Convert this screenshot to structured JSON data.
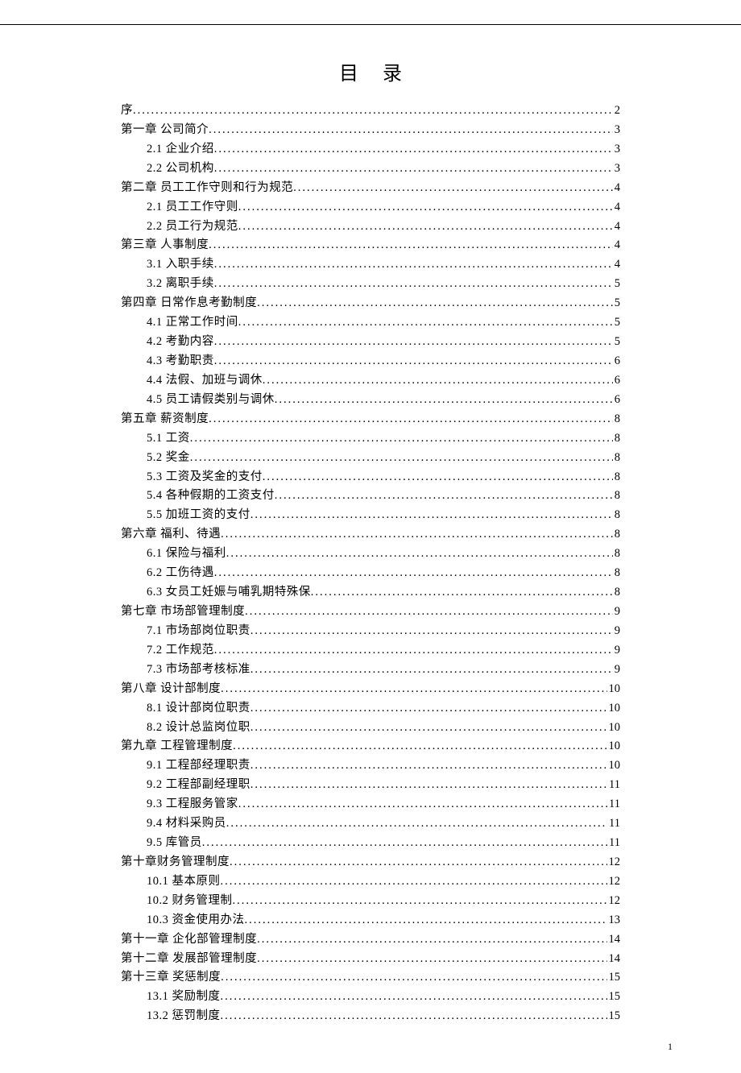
{
  "title": "目录",
  "page_number": "1",
  "toc": [
    {
      "level": 1,
      "label": "序",
      "page": "2"
    },
    {
      "level": 1,
      "label": "第一章  公司简介",
      "page": "3"
    },
    {
      "level": 2,
      "label": "2.1 企业介绍",
      "page": "3"
    },
    {
      "level": 2,
      "label": "2.2 公司机构",
      "page": "3"
    },
    {
      "level": 1,
      "label": "第二章 员工工作守则和行为规范",
      "page": "4"
    },
    {
      "level": 2,
      "label": "2.1 员工工作守则",
      "page": "4"
    },
    {
      "level": 2,
      "label": "2.2 员工行为规范",
      "page": "4"
    },
    {
      "level": 1,
      "label": "第三章 人事制度",
      "page": "4"
    },
    {
      "level": 2,
      "label": "3.1 入职手续",
      "page": "4"
    },
    {
      "level": 2,
      "label": "3.2 离职手续",
      "page": "5"
    },
    {
      "level": 1,
      "label": "第四章 日常作息考勤制度",
      "page": "5"
    },
    {
      "level": 2,
      "label": "4.1 正常工作时间",
      "page": "5"
    },
    {
      "level": 2,
      "label": "4.2 考勤内容",
      "page": "5"
    },
    {
      "level": 2,
      "label": "4.3 考勤职责",
      "page": "6"
    },
    {
      "level": 2,
      "label": "4.4 法假、加班与调休",
      "page": "6"
    },
    {
      "level": 2,
      "label": "4.5 员工请假类别与调休",
      "page": "6"
    },
    {
      "level": 1,
      "label": "第五章 薪资制度",
      "page": "8"
    },
    {
      "level": 2,
      "label": "5.1 工资",
      "page": "8"
    },
    {
      "level": 2,
      "label": "5.2 奖金",
      "page": "8"
    },
    {
      "level": 2,
      "label": "5.3 工资及奖金的支付",
      "page": "8"
    },
    {
      "level": 2,
      "label": "5.4 各种假期的工资支付",
      "page": "8"
    },
    {
      "level": 2,
      "label": "5.5 加班工资的支付",
      "page": "8"
    },
    {
      "level": 1,
      "label": "第六章 福利、待遇",
      "page": "8"
    },
    {
      "level": 2,
      "label": "6.1 保险与福利",
      "page": "8"
    },
    {
      "level": 2,
      "label": "6.2 工伤待遇",
      "page": "8"
    },
    {
      "level": 2,
      "label": "6.3 女员工妊娠与哺乳期特殊保",
      "page": "8"
    },
    {
      "level": 1,
      "label": "第七章 市场部管理制度",
      "page": "9"
    },
    {
      "level": 2,
      "label": "7.1 市场部岗位职责",
      "page": "9"
    },
    {
      "level": 2,
      "label": "7.2 工作规范",
      "page": "9"
    },
    {
      "level": 2,
      "label": "7.3 市场部考核标准",
      "page": "9"
    },
    {
      "level": 1,
      "label": "第八章 设计部制度",
      "page": "10"
    },
    {
      "level": 2,
      "label": "8.1 设计部岗位职责",
      "page": "10"
    },
    {
      "level": 2,
      "label": "8.2 设计总监岗位职",
      "page": "10"
    },
    {
      "level": 1,
      "label": "第九章 工程管理制度",
      "page": "10"
    },
    {
      "level": 2,
      "label": "9.1 工程部经理职责",
      "page": "10"
    },
    {
      "level": 2,
      "label": "9.2 工程部副经理职",
      "page": "11"
    },
    {
      "level": 2,
      "label": "9.3 工程服务管家",
      "page": "11"
    },
    {
      "level": 2,
      "label": "9.4 材料采购员",
      "page": "11"
    },
    {
      "level": 2,
      "label": "9.5 库管员",
      "page": "11"
    },
    {
      "level": 1,
      "label": "第十章财务管理制度",
      "page": "12"
    },
    {
      "level": 2,
      "label": "10.1 基本原则",
      "page": "12"
    },
    {
      "level": 2,
      "label": "10.2 财务管理制",
      "page": "12"
    },
    {
      "level": 2,
      "label": "10.3 资金使用办法",
      "page": "13"
    },
    {
      "level": 1,
      "label": "第十一章 企化部管理制度",
      "page": "14"
    },
    {
      "level": 1,
      "label": "第十二章 发展部管理制度",
      "page": "14"
    },
    {
      "level": 1,
      "label": "第十三章  奖惩制度",
      "page": "15"
    },
    {
      "level": 2,
      "label": "13.1 奖励制度",
      "page": "15"
    },
    {
      "level": 2,
      "label": "13.2 惩罚制度",
      "page": "15"
    }
  ]
}
